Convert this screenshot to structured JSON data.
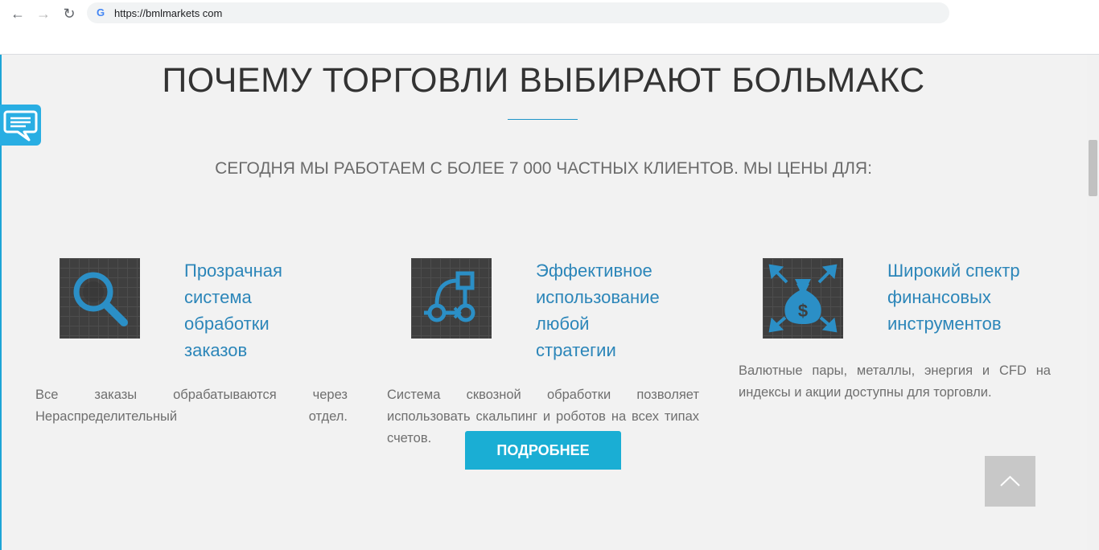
{
  "browser": {
    "back_icon": "←",
    "forward_icon": "→",
    "reload_icon": "↻",
    "google_icon": "G",
    "url": "https://bmlmarkets com"
  },
  "page": {
    "heading": "ПОЧЕМУ ТОРГОВЛИ ВЫБИРАЮТ БОЛЬМАКС",
    "subtitle": "СЕГОДНЯ МЫ РАБОТАЕМ С БОЛЕЕ 7 000 ЧАСТНЫХ КЛИЕНТОВ. МЫ ЦЕНЫ ДЛЯ:",
    "more_button": "ПОДРОБНЕЕ",
    "accent_color": "#2c86b9",
    "button_color": "#1aaed4"
  },
  "features": [
    {
      "icon": "magnifier-icon",
      "title": [
        "Прозрачная",
        "система",
        "обработки",
        "заказов"
      ],
      "text": "Все заказы обрабатываются через Нераспределительный отдел."
    },
    {
      "icon": "flowchart-icon",
      "title": [
        "Эффективное",
        "использование",
        "любой",
        "стратегии"
      ],
      "text": "Система сквозной обработки позволяет использовать скальпинг и роботов на всех типах счетов."
    },
    {
      "icon": "money-bag-icon",
      "title": [
        "Широкий спектр",
        "финансовых",
        "инструментов"
      ],
      "text": "Валютные пары, металлы, энергия и CFD на индексы и акции доступны для торговли."
    }
  ]
}
